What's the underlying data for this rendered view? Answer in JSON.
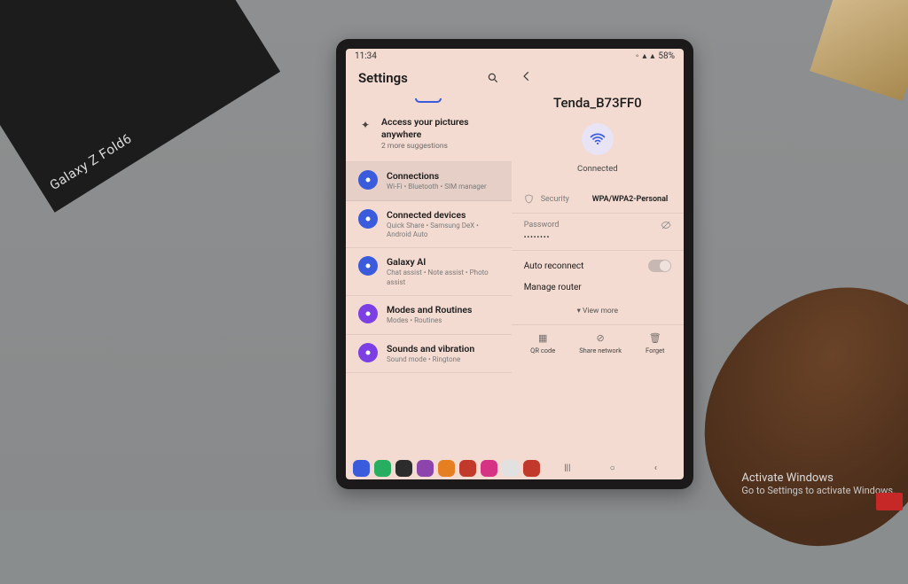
{
  "status": {
    "time": "11:34",
    "battery": "58%"
  },
  "box_label": "Galaxy Z Fold6",
  "left": {
    "title": "Settings",
    "suggestion": {
      "title": "Access your pictures anywhere",
      "sub": "2 more suggestions"
    },
    "items": [
      {
        "title": "Connections",
        "sub": "Wi-Fi • Bluetooth • SIM manager",
        "color": "#3a5bdc",
        "active": true
      },
      {
        "title": "Connected devices",
        "sub": "Quick Share • Samsung DeX • Android Auto",
        "color": "#3a5bdc",
        "active": false
      },
      {
        "title": "Galaxy AI",
        "sub": "Chat assist • Note assist • Photo assist",
        "color": "#3a5bdc",
        "active": false
      },
      {
        "title": "Modes and Routines",
        "sub": "Modes • Routines",
        "color": "#7b3fe4",
        "active": false
      },
      {
        "title": "Sounds and vibration",
        "sub": "Sound mode • Ringtone",
        "color": "#7b3fe4",
        "active": false
      }
    ]
  },
  "right": {
    "ssid": "Tenda_B73FF0",
    "status": "Connected",
    "security_label": "Security",
    "security_value": "WPA/WPA2-Personal",
    "password_label": "Password",
    "password_mask": "••••••••",
    "auto_reconnect": "Auto reconnect",
    "manage_router": "Manage router",
    "view_more": "View more",
    "actions": {
      "qr": "QR code",
      "share": "Share network",
      "forget": "Forget"
    }
  },
  "dock_colors": [
    "#3a5bdc",
    "#27ae60",
    "#2c2c2c",
    "#8e44ad",
    "#e67e22",
    "#c0392b",
    "#d63384",
    "#e1e1e1",
    "#c0392b"
  ],
  "watermark": {
    "title": "Activate Windows",
    "sub": "Go to Settings to activate Windows."
  }
}
